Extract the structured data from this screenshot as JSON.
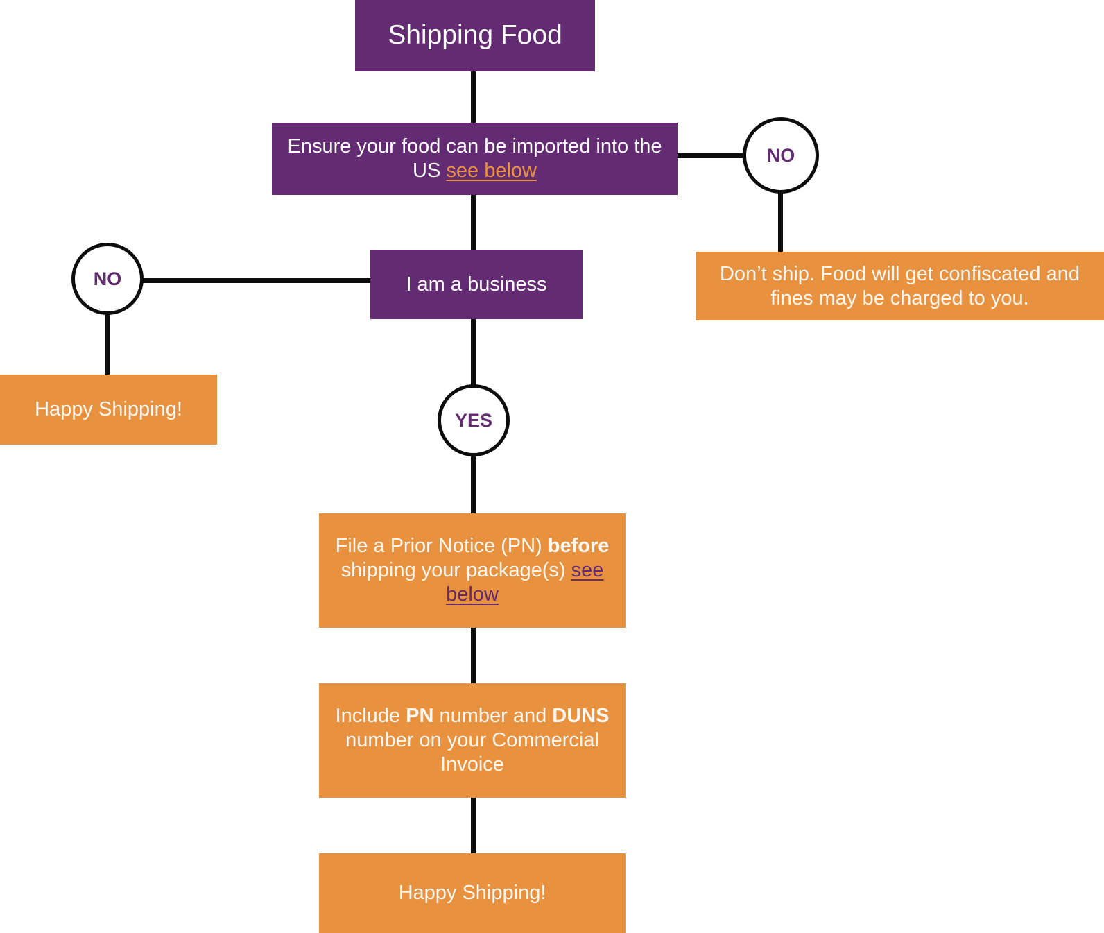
{
  "diagram": {
    "title": "Shipping Food",
    "colors": {
      "purple": "#632b72",
      "orange": "#e8913f",
      "line": "#0d0d0d",
      "text_on_purple": "#ffffff",
      "text_on_orange": "#fdf7f1"
    }
  },
  "nodes": {
    "title": {
      "label": "Shipping Food"
    },
    "ensure": {
      "text_before": "Ensure your food can be imported into the US ",
      "link_label": "see below"
    },
    "business": {
      "label": "I am a business"
    },
    "dontship": {
      "label": "Don’t ship. Food will get confiscated and fines may be charged to you."
    },
    "happy_left": {
      "label": "Happy Shipping!"
    },
    "prior_notice": {
      "part1": "File a Prior Notice (PN) ",
      "bold": "before",
      "part2": " shipping your package(s) ",
      "link_label": "see below"
    },
    "include": {
      "part1": "Include ",
      "bold1": "PN",
      "part2": " number and ",
      "bold2": "DUNS",
      "part3": " number on your Commercial Invoice"
    },
    "happy_bottom": {
      "label": "Happy Shipping!"
    }
  },
  "decisions": {
    "no_right": {
      "label": "NO"
    },
    "no_left": {
      "label": "NO"
    },
    "yes": {
      "label": "YES"
    }
  }
}
